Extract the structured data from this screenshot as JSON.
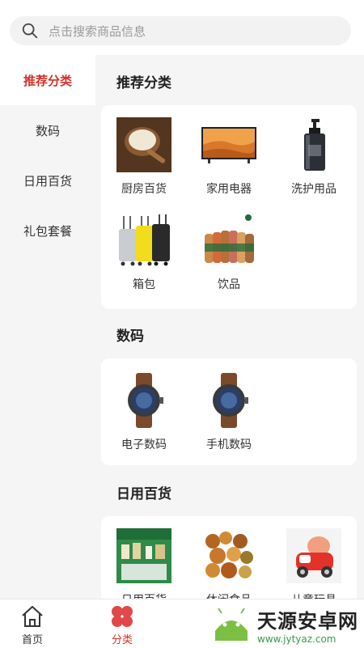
{
  "search": {
    "placeholder": "点击搜索商品信息"
  },
  "sidebar": {
    "items": [
      {
        "label": "推荐分类",
        "active": true
      },
      {
        "label": "数码",
        "active": false
      },
      {
        "label": "日用百货",
        "active": false
      },
      {
        "label": "礼包套餐",
        "active": false
      }
    ]
  },
  "sections": [
    {
      "title": "推荐分类",
      "items": [
        {
          "label": "厨房百货",
          "icon": "rice-bowl-image"
        },
        {
          "label": "家用电器",
          "icon": "tv-image"
        },
        {
          "label": "洗护用品",
          "icon": "pump-bottle-image"
        },
        {
          "label": "箱包",
          "icon": "luggage-image"
        },
        {
          "label": "饮品",
          "icon": "coffee-bottles-image"
        }
      ]
    },
    {
      "title": "数码",
      "items": [
        {
          "label": "电子数码",
          "icon": "smartwatch-image"
        },
        {
          "label": "手机数码",
          "icon": "smartwatch-image"
        }
      ]
    },
    {
      "title": "日用百货",
      "items": [
        {
          "label": "日用百货",
          "icon": "grocery-shelf-image"
        },
        {
          "label": "休闲食品",
          "icon": "snack-nuts-image"
        },
        {
          "label": "儿童玩具",
          "icon": "toy-car-image"
        }
      ]
    }
  ],
  "tabbar": {
    "home": {
      "label": "首页",
      "icon": "home-icon",
      "active": false
    },
    "category": {
      "label": "分类",
      "icon": "category-icon",
      "active": true
    }
  },
  "watermark": {
    "name": "天源安卓网",
    "url": "www.jytyaz.com"
  },
  "colors": {
    "accent": "#d6322a",
    "inactive": "#333333",
    "background": "#f5f5f5"
  }
}
